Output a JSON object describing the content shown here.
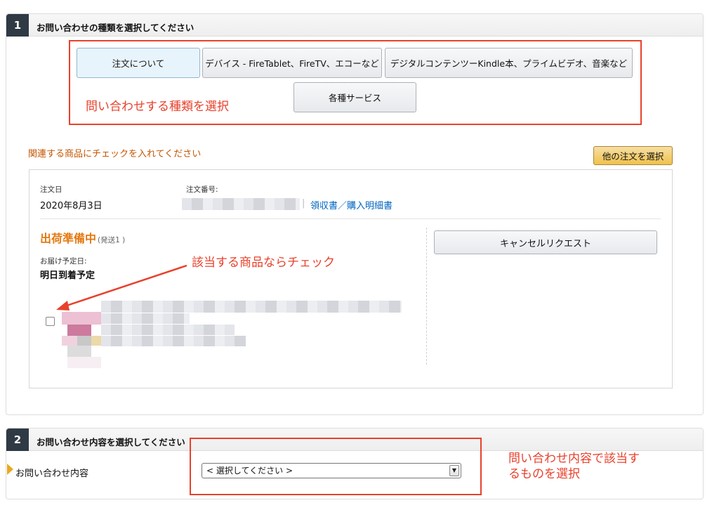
{
  "section1": {
    "number": "1",
    "title": "お問い合わせの種類を選択してください",
    "inquiry_types": [
      {
        "label": "注文について",
        "selected": true
      },
      {
        "label": "デバイス - FireTablet、FireTV、エコーなど",
        "selected": false
      },
      {
        "label": "デジタルコンテンツーKindle本、プライムビデオ、音楽など",
        "selected": false
      },
      {
        "label": "各種サービス",
        "selected": false
      }
    ],
    "annotation_type": "問い合わせする種類を選択",
    "related_heading": "関連する商品にチェックを入れてください",
    "other_order_button": "他の注文を選択",
    "order": {
      "date_label": "注文日",
      "date_value": "2020年8月3日",
      "number_label": "注文番号:",
      "separator": "|",
      "receipt_link": "領収書／購入明細書",
      "status": "出荷準備中",
      "status_sub": "(発送1 )",
      "delivery_label": "お届け予定日:",
      "delivery_value": "明日到着予定",
      "cancel_button": "キャンセルリクエスト",
      "item_checked": false
    },
    "annotation_check": "該当する商品ならチェック"
  },
  "section2": {
    "number": "2",
    "title": "お問い合わせ内容を選択してください",
    "field_label": "お問い合わせ内容",
    "select_value": "< 選択してください >",
    "select_arrow": "▼",
    "annotation_line1": "問い合わせ内容で該当す",
    "annotation_line2": "るものを選択"
  },
  "colors": {
    "annotation_red": "#e8412c",
    "heading_orange": "#c45500",
    "status_orange": "#e47911",
    "link_blue": "#0066c0",
    "header_dark": "#2f3a45",
    "button_yellow": "#f0c14b"
  }
}
